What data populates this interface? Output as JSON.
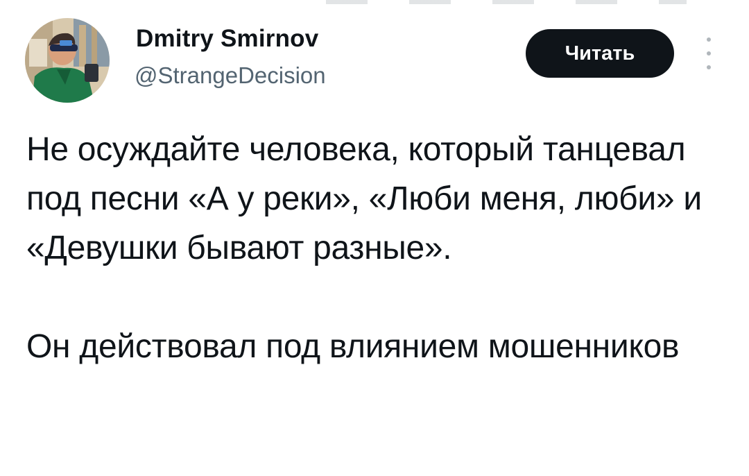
{
  "tweet": {
    "author_name": "Dmitry Smirnov",
    "author_handle": "@StrangeDecision",
    "follow_button_label": "Читать",
    "paragraphs": [
      "Не осуждайте человека, который танцевал под песни «А у реки», «Люби меня, люби» и «Девушки бывают разные».",
      "Он действовал под влиянием мошенников"
    ]
  },
  "icons": {
    "more": "more-vertical-icon"
  },
  "colors": {
    "text": "#0f1419",
    "handle": "#536471",
    "button_bg": "#0f1419",
    "button_text": "#ffffff",
    "more_dots": "#b0b6bb",
    "avatar_jacket": "#1f7a4a",
    "avatar_bg": "#c9b89a"
  }
}
